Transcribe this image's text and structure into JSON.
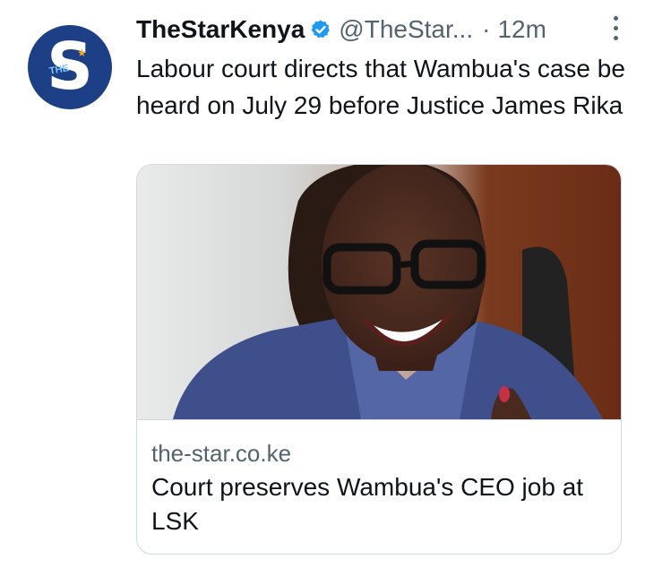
{
  "tweet": {
    "display_name": "TheStarKenya",
    "handle": "@TheStar...",
    "separator": "·",
    "time": "12m",
    "text": "Labour court directs that Wambua's case be heard on July 29 before Justice James Rika",
    "avatar": {
      "letter": "S",
      "small_text": "THE",
      "icon": "star-logo"
    },
    "verified_icon": "verified-badge-icon",
    "more_icon": "more-vertical-icon"
  },
  "card": {
    "image_alt": "woman-with-glasses-smiling",
    "domain": "the-star.co.ke",
    "title": "Court preserves Wambua's CEO job at LSK"
  },
  "colors": {
    "brand_blue": "#1d3f86",
    "verified_blue": "#1d9bf0",
    "muted_text": "#536471",
    "border": "#cfd9de"
  }
}
